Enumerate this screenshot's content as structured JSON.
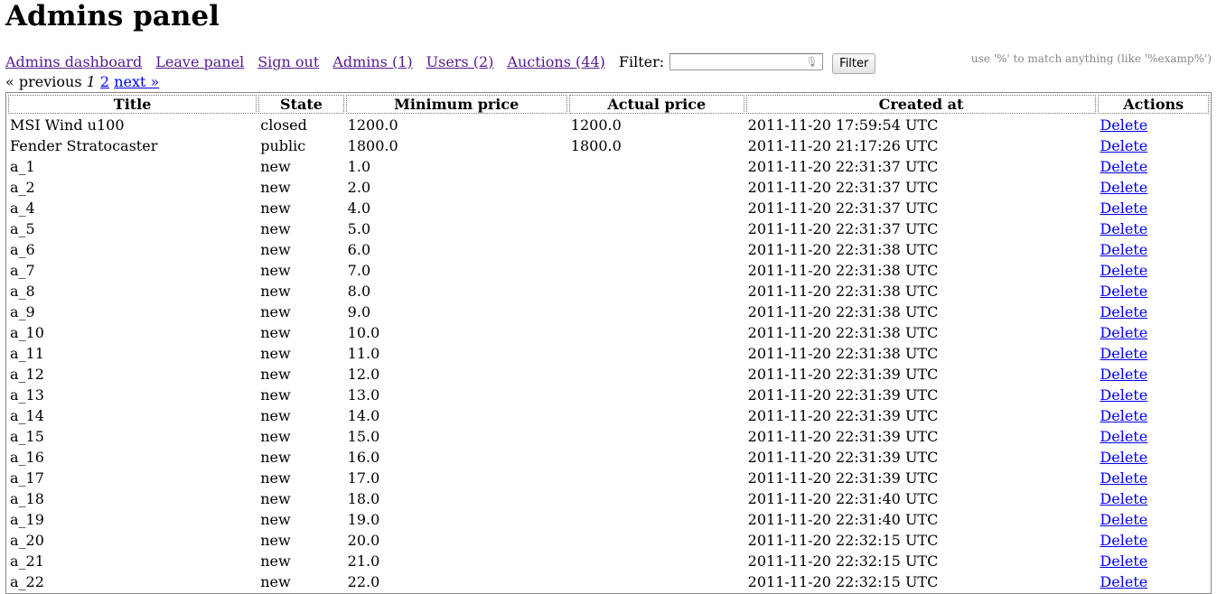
{
  "title": "Admins panel",
  "nav": {
    "links": [
      "Admins dashboard",
      "Leave panel",
      "Sign out",
      "Admins (1)",
      "Users (2)",
      "Auctions (44)"
    ],
    "filter_label": "Filter:",
    "filter_value": "",
    "filter_button": "Filter",
    "hint": "use '%' to match anything (like '%examp%')"
  },
  "pager": {
    "previous": "« previous",
    "current": "1",
    "page2": "2",
    "next": "next »"
  },
  "table": {
    "headers": [
      "Title",
      "State",
      "Minimum price",
      "Actual price",
      "Created at",
      "Actions"
    ],
    "rows": [
      {
        "title": "MSI Wind u100",
        "state": "closed",
        "min": "1200.0",
        "actual": "1200.0",
        "created": "2011-11-20 17:59:54 UTC",
        "action": "Delete"
      },
      {
        "title": "Fender Stratocaster",
        "state": "public",
        "min": "1800.0",
        "actual": "1800.0",
        "created": "2011-11-20 21:17:26 UTC",
        "action": "Delete"
      },
      {
        "title": "a_1",
        "state": "new",
        "min": "1.0",
        "actual": "",
        "created": "2011-11-20 22:31:37 UTC",
        "action": "Delete"
      },
      {
        "title": "a_2",
        "state": "new",
        "min": "2.0",
        "actual": "",
        "created": "2011-11-20 22:31:37 UTC",
        "action": "Delete"
      },
      {
        "title": "a_4",
        "state": "new",
        "min": "4.0",
        "actual": "",
        "created": "2011-11-20 22:31:37 UTC",
        "action": "Delete"
      },
      {
        "title": "a_5",
        "state": "new",
        "min": "5.0",
        "actual": "",
        "created": "2011-11-20 22:31:37 UTC",
        "action": "Delete"
      },
      {
        "title": "a_6",
        "state": "new",
        "min": "6.0",
        "actual": "",
        "created": "2011-11-20 22:31:38 UTC",
        "action": "Delete"
      },
      {
        "title": "a_7",
        "state": "new",
        "min": "7.0",
        "actual": "",
        "created": "2011-11-20 22:31:38 UTC",
        "action": "Delete"
      },
      {
        "title": "a_8",
        "state": "new",
        "min": "8.0",
        "actual": "",
        "created": "2011-11-20 22:31:38 UTC",
        "action": "Delete"
      },
      {
        "title": "a_9",
        "state": "new",
        "min": "9.0",
        "actual": "",
        "created": "2011-11-20 22:31:38 UTC",
        "action": "Delete"
      },
      {
        "title": "a_10",
        "state": "new",
        "min": "10.0",
        "actual": "",
        "created": "2011-11-20 22:31:38 UTC",
        "action": "Delete"
      },
      {
        "title": "a_11",
        "state": "new",
        "min": "11.0",
        "actual": "",
        "created": "2011-11-20 22:31:38 UTC",
        "action": "Delete"
      },
      {
        "title": "a_12",
        "state": "new",
        "min": "12.0",
        "actual": "",
        "created": "2011-11-20 22:31:39 UTC",
        "action": "Delete"
      },
      {
        "title": "a_13",
        "state": "new",
        "min": "13.0",
        "actual": "",
        "created": "2011-11-20 22:31:39 UTC",
        "action": "Delete"
      },
      {
        "title": "a_14",
        "state": "new",
        "min": "14.0",
        "actual": "",
        "created": "2011-11-20 22:31:39 UTC",
        "action": "Delete"
      },
      {
        "title": "a_15",
        "state": "new",
        "min": "15.0",
        "actual": "",
        "created": "2011-11-20 22:31:39 UTC",
        "action": "Delete"
      },
      {
        "title": "a_16",
        "state": "new",
        "min": "16.0",
        "actual": "",
        "created": "2011-11-20 22:31:39 UTC",
        "action": "Delete"
      },
      {
        "title": "a_17",
        "state": "new",
        "min": "17.0",
        "actual": "",
        "created": "2011-11-20 22:31:39 UTC",
        "action": "Delete"
      },
      {
        "title": "a_18",
        "state": "new",
        "min": "18.0",
        "actual": "",
        "created": "2011-11-20 22:31:40 UTC",
        "action": "Delete"
      },
      {
        "title": "a_19",
        "state": "new",
        "min": "19.0",
        "actual": "",
        "created": "2011-11-20 22:31:40 UTC",
        "action": "Delete"
      },
      {
        "title": "a_20",
        "state": "new",
        "min": "20.0",
        "actual": "",
        "created": "2011-11-20 22:32:15 UTC",
        "action": "Delete"
      },
      {
        "title": "a_21",
        "state": "new",
        "min": "21.0",
        "actual": "",
        "created": "2011-11-20 22:32:15 UTC",
        "action": "Delete"
      },
      {
        "title": "a_22",
        "state": "new",
        "min": "22.0",
        "actual": "",
        "created": "2011-11-20 22:32:15 UTC",
        "action": "Delete"
      }
    ]
  }
}
